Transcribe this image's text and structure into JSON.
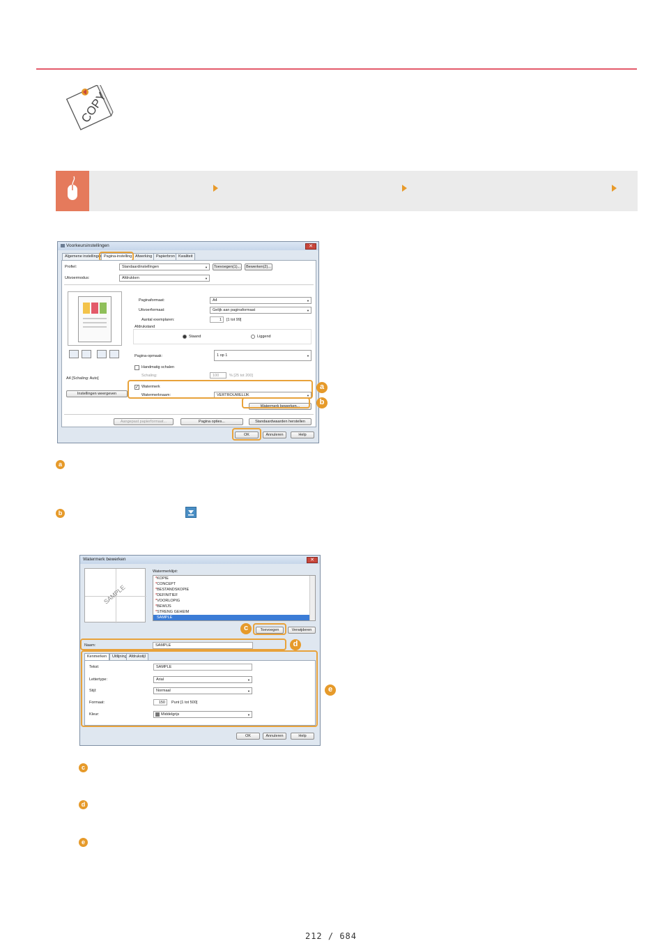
{
  "icon": {
    "label": "COPY"
  },
  "dialog1": {
    "title": "Voorkeursinstellingen",
    "tabs": [
      "Algemene instellingen",
      "Pagina-instelling",
      "Afwerking",
      "Papierbron",
      "Kwaliteit"
    ],
    "profile_label": "Profiel:",
    "profile_value": "Standaardinstellingen",
    "add_button": "Toevoegen(1)...",
    "edit_button": "Bewerken(2)...",
    "output_label": "Uitvoermodus:",
    "output_value": "Afdrukken",
    "paper_size_label": "Paginaformaat:",
    "paper_size_value": "A4",
    "output_size_label": "Uitvoerformaat:",
    "output_size_value": "Gelijk aan paginaformaat",
    "copies_label": "Aantal exemplaren:",
    "copies_value": "1",
    "copies_range": "[1 tot 99]",
    "orientation_label": "Afdrukstand",
    "portrait": "Staand",
    "landscape": "Liggend",
    "layout_label": "Pagina-opmaak:",
    "layout_value": "1 op 1",
    "manual_scale": "Handmatig schalen",
    "scale_label": "Schaling:",
    "scale_value": "100",
    "scale_range": "% [25 tot 200]",
    "watermark_check": "Watermerk",
    "watermark_name_label": "Watermerknaam:",
    "watermark_name_value": "VERTROUWELIJK",
    "edit_watermark_button": "Watermerk bewerken...",
    "preview_caption": "A4 [Schaling: Auto]",
    "view_settings_button": "Instellingen weergeven",
    "custom_paper_button": "Aangepast papierformaat...",
    "page_options_button": "Pagina opties...",
    "restore_defaults_button": "Standaardwaarden herstellen",
    "ok": "OK",
    "cancel": "Annuleren",
    "help": "Help"
  },
  "dialog2": {
    "title": "Watermerk bewerken",
    "list_label": "Watermerklijst:",
    "list_items": [
      "KOPIE",
      "CONCEPT",
      "BESTANDSKOPIE",
      "DEFINITIEF",
      "VOORLOPIG",
      "BEWIJS",
      "STRENG GEHEIM",
      "SAMPLE"
    ],
    "selected_item": "SAMPLE",
    "preview_text": "SAMPLE",
    "add_button": "Toevoegen",
    "remove_button": "Verwijderen",
    "name_label": "Naam:",
    "name_value": "SAMPLE",
    "tabs": [
      "Kenmerken",
      "Uitlijning",
      "Afdrukstijl"
    ],
    "text_label": "Tekst:",
    "text_value": "SAMPLE",
    "font_label": "Lettertype:",
    "font_value": "Arial",
    "style_label": "Stijl:",
    "style_value": "Normaal",
    "size_label": "Formaat:",
    "size_value": "150",
    "size_range": "Punt [1 tot 500]",
    "color_label": "Kleur:",
    "color_value": "Middelgrijs",
    "ok": "OK",
    "cancel": "Annuleren",
    "help": "Help"
  },
  "callouts": {
    "a": "a",
    "b": "b",
    "c": "c",
    "d": "d",
    "e": "e"
  },
  "page_number": "212 / 684",
  "colors": {
    "rule": "#e35a6a",
    "accent": "#e69a2a",
    "step_icon": "#e57a5c",
    "step_bar": "#ebebeb"
  }
}
